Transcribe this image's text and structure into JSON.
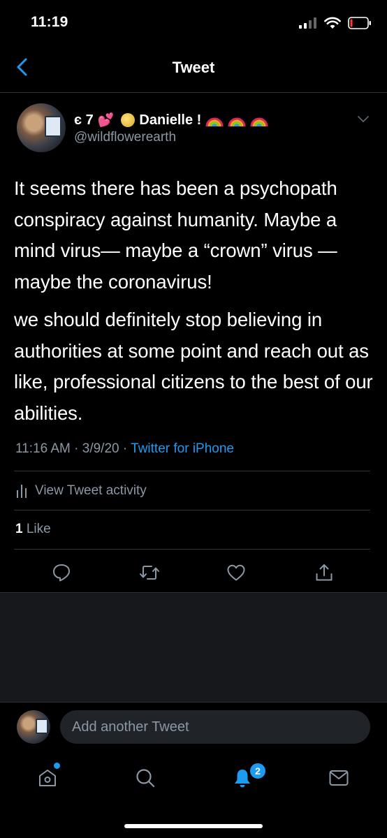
{
  "status_bar": {
    "time": "11:19"
  },
  "nav": {
    "title": "Tweet"
  },
  "author": {
    "name_prefix": "є 7",
    "name": "Danielle !",
    "handle": "@wildflowerearth"
  },
  "tweet": {
    "paragraphs": [
      "It seems there has been a psychopath conspiracy against humanity. Maybe a mind virus— maybe a “crown” virus — maybe the coronavirus!",
      "we should definitely stop believing in authorities at some point and reach out as like, professional citizens to the best of our abilities."
    ],
    "time": "11:16 AM",
    "date": "3/9/20",
    "separator": "·",
    "source": "Twitter for iPhone"
  },
  "activity": {
    "label": "View Tweet activity"
  },
  "stats": {
    "likes_count": "1",
    "likes_label": "Like"
  },
  "composer": {
    "placeholder": "Add another Tweet"
  },
  "tab_bar": {
    "notifications_badge": "2"
  },
  "colors": {
    "accent": "#1d9bf0",
    "secondary_text": "#8b98a5",
    "divider": "#2f3336"
  },
  "icons": {
    "back": "chevron-left-icon",
    "caret": "chevron-down-icon",
    "reply": "comment-icon",
    "retweet": "retweet-icon",
    "like": "heart-icon",
    "share": "share-icon",
    "home": "home-icon",
    "search": "search-icon",
    "notifications": "bell-icon",
    "messages": "mail-icon"
  }
}
